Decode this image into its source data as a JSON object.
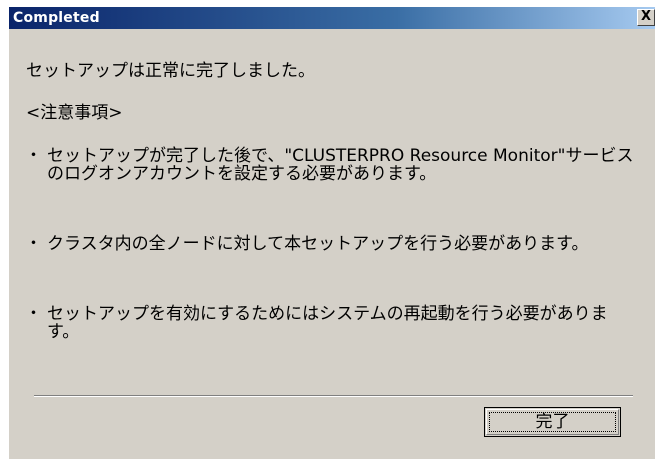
{
  "window": {
    "title": "Completed",
    "close_label": "X"
  },
  "message": {
    "headline": "セットアップは正常に完了しました。",
    "notes_heading": "<注意事項>",
    "bullet_char": "・",
    "notes": [
      "セットアップが完了した後で、\"CLUSTERPRO Resource Monitor\"サービスのログオンアカウントを設定する必要があります。",
      "クラスタ内の全ノードに対して本セットアップを行う必要があります。",
      "セットアップを有効にするためにはシステムの再起動を行う必要があります。"
    ]
  },
  "buttons": {
    "done_label": "完了"
  }
}
